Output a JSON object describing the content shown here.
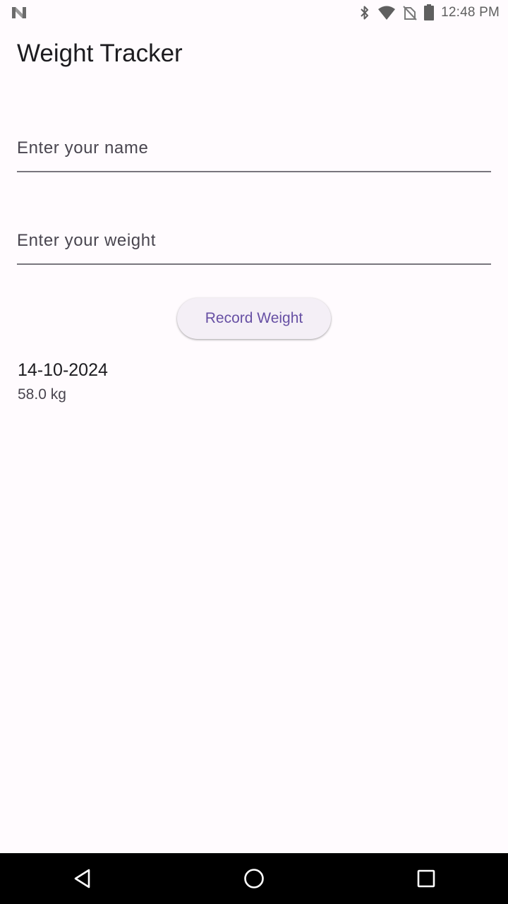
{
  "status_bar": {
    "time": "12:48 PM",
    "icons": [
      "app-notification-icon",
      "bluetooth-icon",
      "wifi-icon",
      "no-sim-icon",
      "battery-icon"
    ]
  },
  "app": {
    "title": "Weight Tracker"
  },
  "form": {
    "name_field": {
      "placeholder": "Enter your name",
      "value": ""
    },
    "weight_field": {
      "placeholder": "Enter your weight",
      "value": ""
    },
    "record_button_label": "Record Weight"
  },
  "entries": [
    {
      "date": "14-10-2024",
      "weight": "58.0 kg"
    }
  ],
  "nav_bar": {
    "icons": [
      "back-icon",
      "home-icon",
      "recents-icon"
    ]
  },
  "colors": {
    "background": "#fffbfe",
    "accent": "#6750a4",
    "button_background": "#f4eff6",
    "text_primary": "#1c1b1f",
    "text_secondary": "#49454f",
    "underline": "#79767d"
  }
}
